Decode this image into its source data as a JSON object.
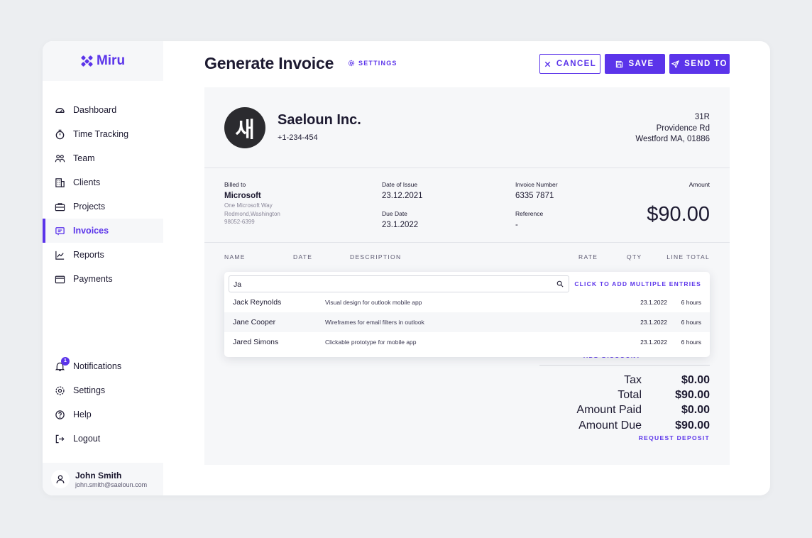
{
  "app": {
    "brand": "Miru",
    "brand_color": "#5b34ea"
  },
  "sidebar": {
    "items": [
      {
        "label": "Dashboard",
        "icon": "gauge-icon"
      },
      {
        "label": "Time Tracking",
        "icon": "stopwatch-icon"
      },
      {
        "label": "Team",
        "icon": "team-icon"
      },
      {
        "label": "Clients",
        "icon": "building-icon"
      },
      {
        "label": "Projects",
        "icon": "briefcase-icon"
      },
      {
        "label": "Invoices",
        "icon": "invoice-icon",
        "active": true
      },
      {
        "label": "Reports",
        "icon": "chart-line-icon"
      },
      {
        "label": "Payments",
        "icon": "wallet-icon"
      }
    ],
    "bottom_items": [
      {
        "label": "Notifications",
        "icon": "bell-icon",
        "badge": "1"
      },
      {
        "label": "Settings",
        "icon": "gear-icon"
      },
      {
        "label": "Help",
        "icon": "help-icon"
      },
      {
        "label": "Logout",
        "icon": "logout-icon"
      }
    ],
    "user": {
      "name": "John Smith",
      "email": "john.smith@saeloun.com"
    }
  },
  "header": {
    "title": "Generate Invoice",
    "settings_label": "SETTINGS",
    "cancel_label": "CANCEL",
    "save_label": "SAVE",
    "send_label": "SEND TO"
  },
  "invoice": {
    "company": {
      "logo_text": "새",
      "name": "Saeloun Inc.",
      "phone": "+1-234-454",
      "address_line1": "31R",
      "address_line2": "Providence Rd",
      "address_line3": "Westford MA, 01886"
    },
    "billed_to": {
      "label": "Billed to",
      "name": "Microsoft",
      "line1": "One Microsoft Way",
      "line2": "Redmond,Washington",
      "line3": "98052-6399"
    },
    "date_of_issue": {
      "label": "Date of Issue",
      "value": "23.12.2021"
    },
    "due_date": {
      "label": "Due Date",
      "value": "23.1.2022"
    },
    "invoice_number": {
      "label": "Invoice Number",
      "value": "6335 7871"
    },
    "reference": {
      "label": "Reference",
      "value": "-"
    },
    "amount": {
      "label": "Amount",
      "value": "$90.00"
    },
    "columns": [
      "NAME",
      "DATE",
      "DESCRIPTION",
      "RATE",
      "QTY",
      "LINE TOTAL"
    ],
    "add_discount_label": "ADD DISCOUNT",
    "totals": [
      {
        "label": "Tax",
        "value": "$0.00"
      },
      {
        "label": "Total",
        "value": "$90.00"
      },
      {
        "label": "Amount Paid",
        "value": "$0.00"
      },
      {
        "label": "Amount Due",
        "value": "$90.00"
      }
    ],
    "request_deposit_label": "REQUEST DEPOSIT"
  },
  "dropdown": {
    "search_value": "Ja",
    "multi_label": "CLICK TO ADD MULTIPLE ENTRIES",
    "entries": [
      {
        "name": "Jack Reynolds",
        "description": "Visual design for outlook mobile app",
        "date": "23.1.2022",
        "hours": "6 hours"
      },
      {
        "name": "Jane Cooper",
        "description": "Wireframes for email filters in outlook",
        "date": "23.1.2022",
        "hours": "6 hours"
      },
      {
        "name": "Jared Simons",
        "description": "Clickable prototype for mobile app",
        "date": "23.1.2022",
        "hours": "6 hours"
      }
    ]
  }
}
